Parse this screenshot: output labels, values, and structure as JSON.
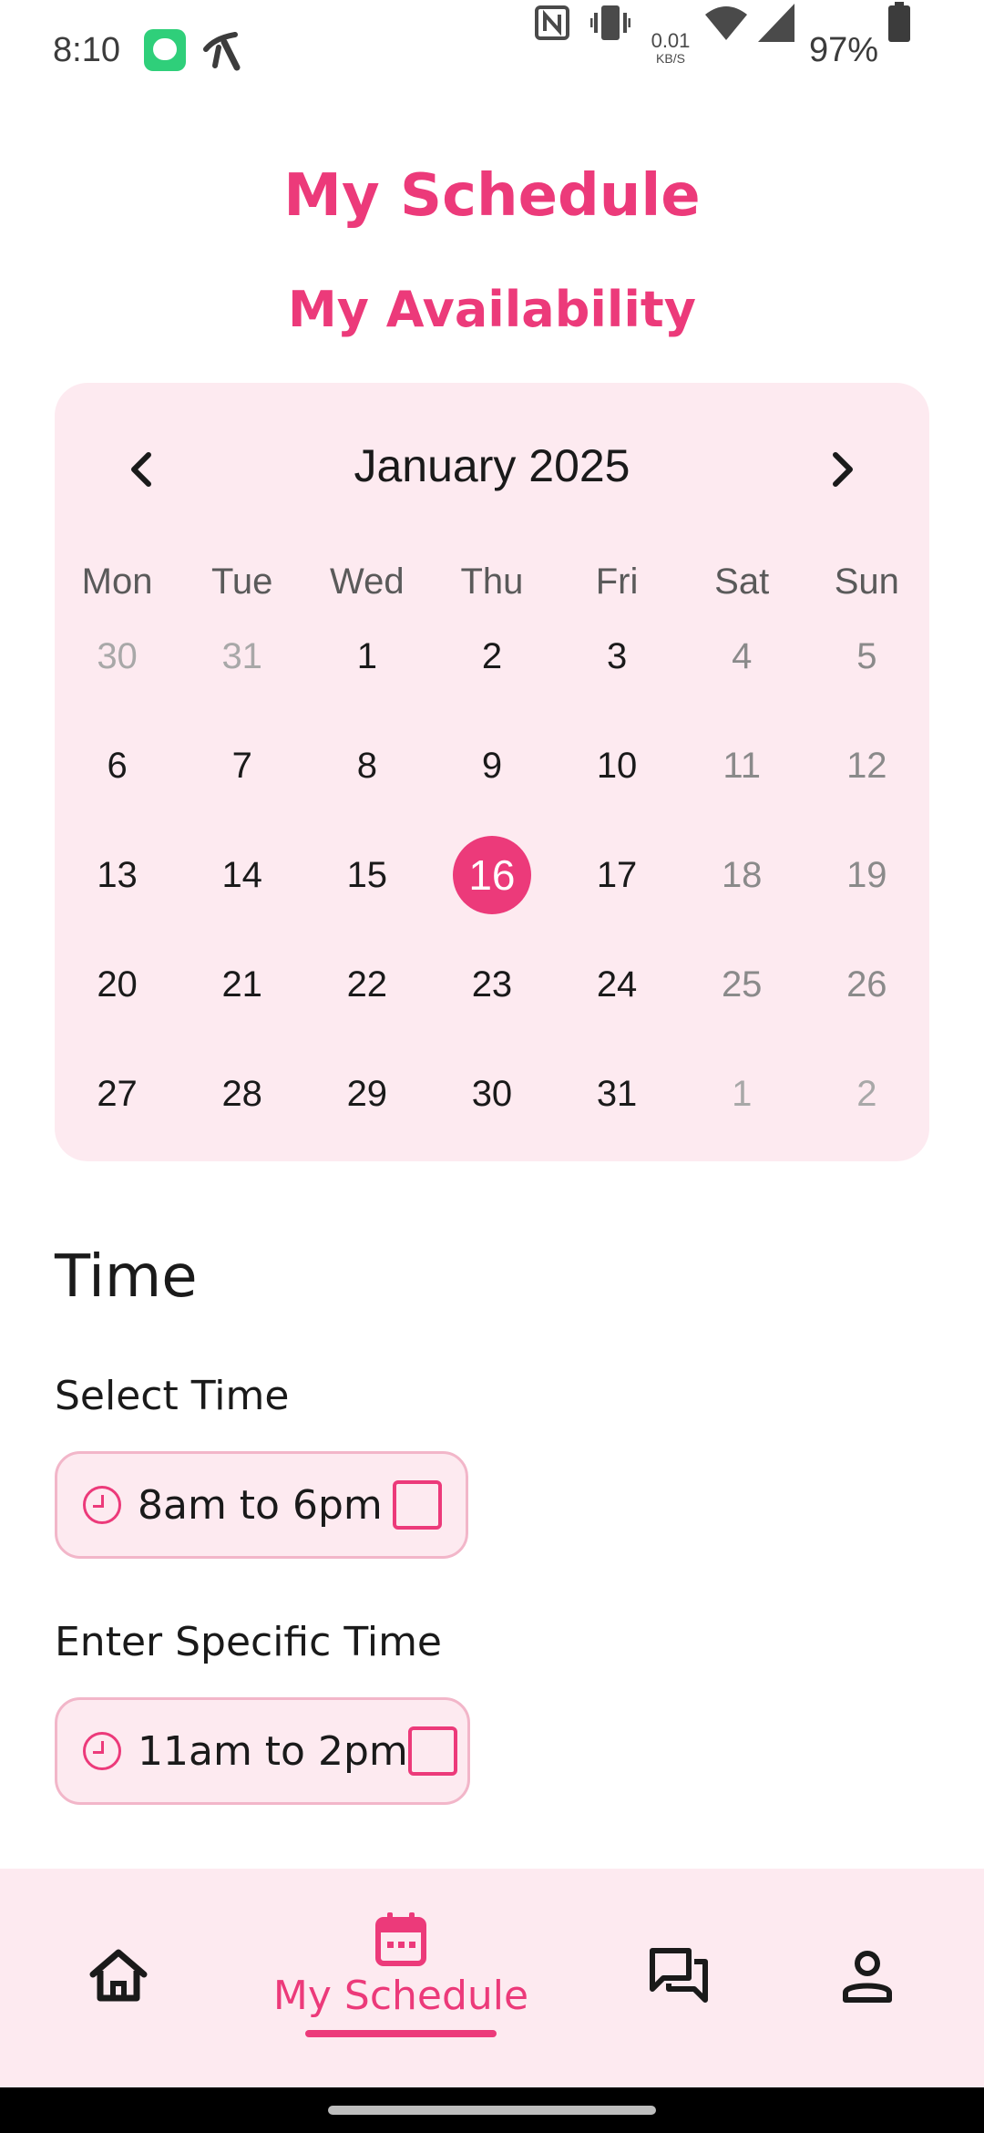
{
  "status_bar": {
    "time": "8:10",
    "speed_value": "0.01",
    "speed_unit": "KB/S",
    "battery": "97%",
    "icons": [
      "chat-app-icon",
      "carrier-icon",
      "nfc-icon",
      "vibrate-icon",
      "wifi-icon",
      "signal-icon",
      "battery-icon"
    ]
  },
  "header": {
    "title": "My Schedule",
    "subtitle": "My Availability"
  },
  "calendar": {
    "month_label": "January 2025",
    "weekdays": [
      "Mon",
      "Tue",
      "Wed",
      "Thu",
      "Fri",
      "Sat",
      "Sun"
    ],
    "weeks": [
      [
        "30",
        "31",
        "1",
        "2",
        "3",
        "4",
        "5"
      ],
      [
        "6",
        "7",
        "8",
        "9",
        "10",
        "11",
        "12"
      ],
      [
        "13",
        "14",
        "15",
        "16",
        "17",
        "18",
        "19"
      ],
      [
        "20",
        "21",
        "22",
        "23",
        "24",
        "25",
        "26"
      ],
      [
        "27",
        "28",
        "29",
        "30",
        "31",
        "1",
        "2"
      ]
    ],
    "selected_day": "16"
  },
  "time_section": {
    "heading": "Time",
    "select_label": "Select Time",
    "select_option": "8am to 6pm",
    "specific_label": "Enter Specific Time",
    "specific_option": "11am to 2pm"
  },
  "bottom_nav": {
    "active_label": "My Schedule",
    "items": [
      "home-icon",
      "calendar-icon",
      "chat-icon",
      "profile-icon"
    ]
  },
  "colors": {
    "accent": "#ec3a7a",
    "panel": "#fdeaf0"
  }
}
